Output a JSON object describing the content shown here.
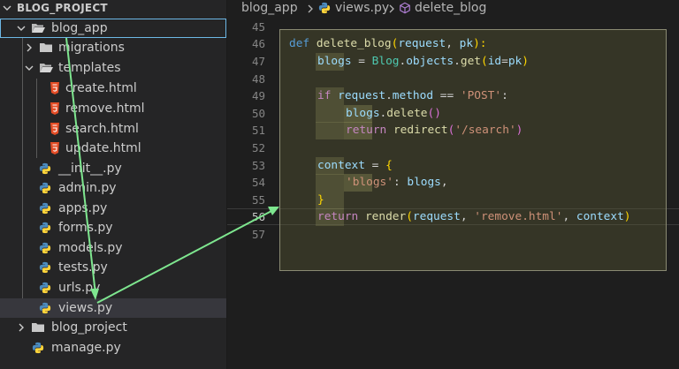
{
  "explorer": {
    "title": "BLOG_PROJECT",
    "items": [
      {
        "label": "blog_app",
        "kind": "folder",
        "expanded": true,
        "focused": true
      },
      {
        "label": "migrations",
        "kind": "folder",
        "expanded": false
      },
      {
        "label": "templates",
        "kind": "folder",
        "expanded": true
      },
      {
        "label": "create.html",
        "kind": "html"
      },
      {
        "label": "remove.html",
        "kind": "html"
      },
      {
        "label": "search.html",
        "kind": "html"
      },
      {
        "label": "update.html",
        "kind": "html"
      },
      {
        "label": "__init__.py",
        "kind": "python"
      },
      {
        "label": "admin.py",
        "kind": "python"
      },
      {
        "label": "apps.py",
        "kind": "python"
      },
      {
        "label": "forms.py",
        "kind": "python"
      },
      {
        "label": "models.py",
        "kind": "python"
      },
      {
        "label": "tests.py",
        "kind": "python"
      },
      {
        "label": "urls.py",
        "kind": "python"
      },
      {
        "label": "views.py",
        "kind": "python",
        "selected": true
      },
      {
        "label": "blog_project",
        "kind": "folder",
        "expanded": false
      },
      {
        "label": "manage.py",
        "kind": "python"
      }
    ]
  },
  "breadcrumb": {
    "items": [
      "blog_app",
      "views.py",
      "delete_blog"
    ],
    "icons": [
      "chevron-right-icon",
      "python-file-icon",
      "symbol-method-icon"
    ]
  },
  "editor": {
    "line_numbers": [
      "45",
      "46",
      "47",
      "48",
      "49",
      "50",
      "51",
      "52",
      "53",
      "54",
      "55",
      "56",
      "57"
    ],
    "active_line": "56",
    "code": {
      "l46": {
        "kw": "def",
        "fn": "delete_blog",
        "op1": "(",
        "a1": "request",
        "sep": ", ",
        "a2": "pk",
        "cl": "):"
      },
      "l47": {
        "var": "blogs",
        "eq": " = ",
        "cls": "Blog",
        "dot1": ".",
        "attr1": "objects",
        "dot2": ".",
        "call": "get",
        "paren": "(",
        "kwarg": "id",
        "eq2": "=",
        "arg": "pk",
        "close": ")"
      },
      "l49": {
        "kw": "if",
        "sp1": " ",
        "v1": "request",
        "dot": ".",
        "v2": "method",
        "op": " == ",
        "str": "'POST'",
        "colon": ":"
      },
      "l50": {
        "v1": "blogs",
        "dot": ".",
        "fn": "delete",
        "paren": "()"
      },
      "l51": {
        "kw": "return",
        "sp": " ",
        "fn": "redirect",
        "op": "(",
        "str": "'/search'",
        "cl": ")"
      },
      "l53": {
        "var": "context",
        "eq": " = ",
        "brace": "{"
      },
      "l54": {
        "key": "'blogs'",
        "colon": ": ",
        "val": "blogs",
        "comma": ","
      },
      "l55": {
        "brace": "}"
      },
      "l56": {
        "kw": "return",
        "sp": " ",
        "fn": "render",
        "op": "(",
        "a1": "request",
        "c1": ", ",
        "str": "'remove.html'",
        "c2": ", ",
        "a2": "context",
        "cl": ")"
      }
    }
  },
  "colors": {
    "keyword": "#569cd6",
    "function": "#dcdcaa",
    "parameter": "#9cdcfe",
    "class": "#4ec9b0",
    "string": "#ce9178",
    "control": "#c586c0",
    "bracket": "#ffd700",
    "annotation_arrow": "#7ee68f",
    "selection_outline": "#6db8e6",
    "highlight_box": "#8a8a72"
  },
  "annotations": {
    "arrows": [
      "blog_app to views.py",
      "views.py to editor line 55"
    ]
  }
}
